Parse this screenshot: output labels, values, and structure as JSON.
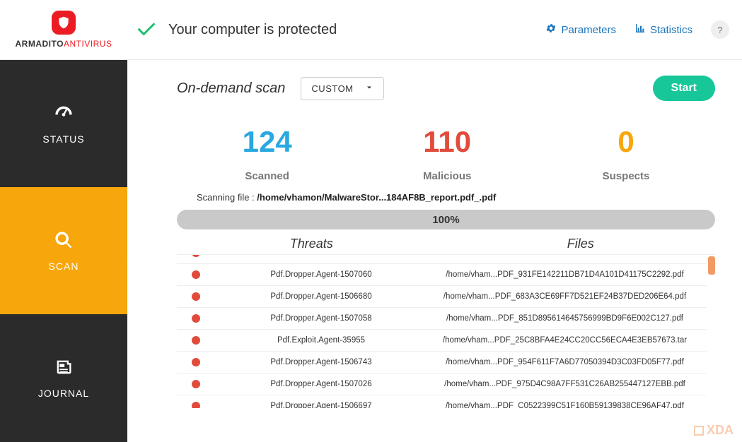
{
  "brand": {
    "name1": "ARMADITO",
    "name2": "ANTIVIRUS"
  },
  "header": {
    "status_text": "Your computer is protected",
    "parameters": "Parameters",
    "statistics": "Statistics",
    "help": "?"
  },
  "sidebar": {
    "items": [
      {
        "id": "status",
        "label": "STATUS",
        "icon": "gauge-icon"
      },
      {
        "id": "scan",
        "label": "SCAN",
        "icon": "search-icon"
      },
      {
        "id": "journal",
        "label": "JOURNAL",
        "icon": "newspaper-icon"
      }
    ],
    "active": "scan"
  },
  "scan": {
    "title": "On-demand scan",
    "mode": "CUSTOM",
    "start_label": "Start",
    "counters": {
      "scanned": {
        "value": "124",
        "label": "Scanned"
      },
      "malicious": {
        "value": "110",
        "label": "Malicious"
      },
      "suspects": {
        "value": "0",
        "label": "Suspects"
      }
    },
    "scanning_prefix": "Scanning file : ",
    "scanning_path": "/home/vhamon/MalwareStor...184AF8B_report.pdf_.pdf",
    "progress": "100%",
    "table_headers": {
      "threats": "Threats",
      "files": "Files"
    },
    "rows": [
      {
        "threat": "Pdf.Dropper.Agent-1507060",
        "file": "/home/vham...PDF_931FE142211DB71D4A101D41175C2292.pdf"
      },
      {
        "threat": "Pdf.Dropper.Agent-1506680",
        "file": "/home/vham...PDF_683A3CE69FF7D521EF24B37DED206E64.pdf"
      },
      {
        "threat": "Pdf.Dropper.Agent-1507058",
        "file": "/home/vham...PDF_851D895614645756999BD9F6E002C127.pdf"
      },
      {
        "threat": "Pdf.Exploit.Agent-35955",
        "file": "/home/vham...PDF_25C8BFA4E24CC20CC56ECA4E3EB57673.tar"
      },
      {
        "threat": "Pdf.Dropper.Agent-1506743",
        "file": "/home/vham...PDF_954F611F7A6D77050394D3C03FD05F77.pdf"
      },
      {
        "threat": "Pdf.Dropper.Agent-1507026",
        "file": "/home/vham...PDF_975D4C98A7FF531C26AB255447127EBB.pdf"
      },
      {
        "threat": "Pdf.Dropper.Agent-1506697",
        "file": "/home/vham...PDF_C0522399C51F160B59139838CE96AF47.pdf"
      }
    ]
  },
  "watermark": "XDA"
}
